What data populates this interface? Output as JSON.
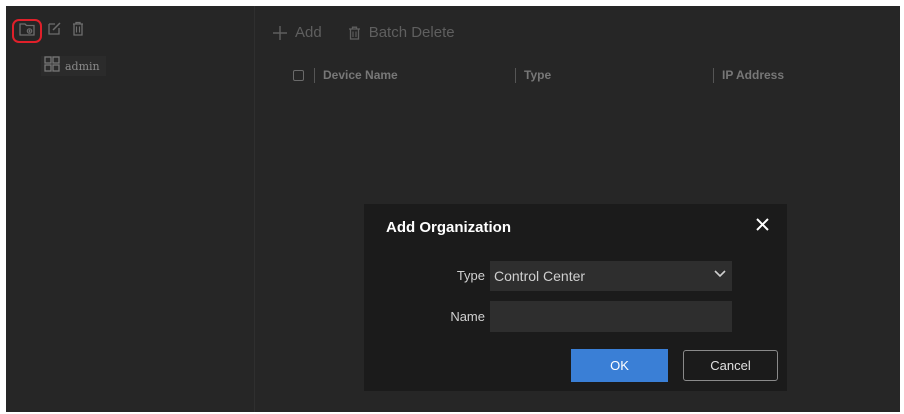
{
  "tree": {
    "toolbar": {
      "icons": [
        "add-folder-icon",
        "edit-icon",
        "delete-icon"
      ],
      "highlight_color": "#e0202a"
    },
    "items": [
      {
        "label": "admin",
        "icon": "organization-icon"
      }
    ]
  },
  "toolbar": {
    "add_label": "Add",
    "batch_delete_label": "Batch Delete"
  },
  "table": {
    "columns": [
      "Device Name",
      "Type",
      "IP Address"
    ],
    "rows": []
  },
  "dialog": {
    "title": "Add Organization",
    "type_label": "Type",
    "type_value": "Control Center",
    "name_label": "Name",
    "name_value": "",
    "ok_label": "OK",
    "cancel_label": "Cancel"
  },
  "colors": {
    "background": "#262626",
    "dialog_background": "#1b1b1b",
    "primary": "#3a7fd6"
  }
}
